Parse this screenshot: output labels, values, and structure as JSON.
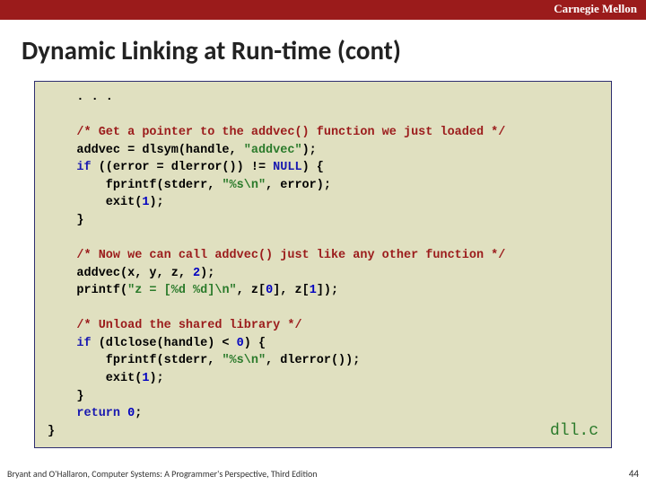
{
  "header": {
    "university": "Carnegie Mellon",
    "title": "Dynamic Linking at Run-time (cont)"
  },
  "code": {
    "dots": ". . .",
    "block1": {
      "comment": "/* Get a pointer to the addvec() function we just loaded */",
      "l1a": "addvec = dlsym(handle, ",
      "l1b": "\"addvec\"",
      "l1c": ");",
      "l2a": "if",
      "l2b": " ((error = dlerror()) != ",
      "l2c": "NULL",
      "l2d": ") {",
      "l3a": "    fprintf(stderr, ",
      "l3b": "\"%s\\n\"",
      "l3c": ", error);",
      "l4a": "    exit(",
      "l4b": "1",
      "l4c": ");",
      "l5": "}"
    },
    "block2": {
      "comment": "/* Now we can call addvec() just like any other function */",
      "l1a": "addvec(x, y, z, ",
      "l1b": "2",
      "l1c": ");",
      "l2a": "printf(",
      "l2b": "\"z = [%d %d]\\n\"",
      "l2c": ", z[",
      "l2d": "0",
      "l2e": "], z[",
      "l2f": "1",
      "l2g": "]);"
    },
    "block3": {
      "comment": "/* Unload the shared library */",
      "l1a": "if",
      "l1b": " (dlclose(handle) < ",
      "l1c": "0",
      "l1d": ") {",
      "l2a": "    fprintf(stderr, ",
      "l2b": "\"%s\\n\"",
      "l2c": ", dlerror());",
      "l3a": "    exit(",
      "l3b": "1",
      "l3c": ");",
      "l4": "}",
      "l5a": "return",
      "l5b": " ",
      "l5c": "0",
      "l5d": ";"
    },
    "close_brace": "}",
    "file": "dll.c"
  },
  "footer": {
    "citation": "Bryant and O'Hallaron, Computer Systems: A Programmer's Perspective, Third Edition",
    "page": "44"
  }
}
